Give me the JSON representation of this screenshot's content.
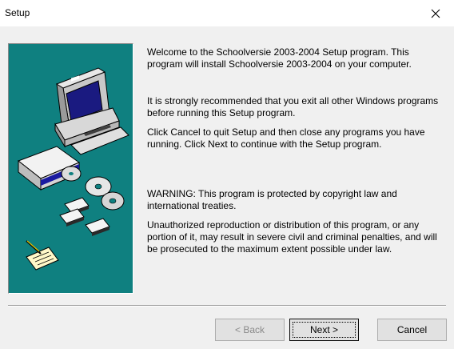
{
  "window": {
    "title": "Setup",
    "close_icon": "close-icon"
  },
  "artwork": {
    "icon_name": "computer-setup-illustration",
    "background_color": "#0f8080"
  },
  "content": {
    "paragraph_1": "Welcome to the Schoolversie 2003-2004 Setup program. This program will install Schoolversie 2003-2004 on your computer.",
    "paragraph_2": "It is strongly recommended that you exit all other Windows programs before running this Setup program.",
    "paragraph_3": "Click Cancel to quit Setup and then close any programs you have running. Click Next to continue with the Setup program.",
    "paragraph_4": "WARNING: This program is protected by copyright law and international treaties.",
    "paragraph_5": "Unauthorized reproduction or distribution of this program, or any portion of it, may result in severe civil and criminal penalties, and will be prosecuted to the maximum extent possible under law."
  },
  "buttons": {
    "back_label": "< Back",
    "next_label": "Next >",
    "cancel_label": "Cancel",
    "back_enabled": false
  }
}
